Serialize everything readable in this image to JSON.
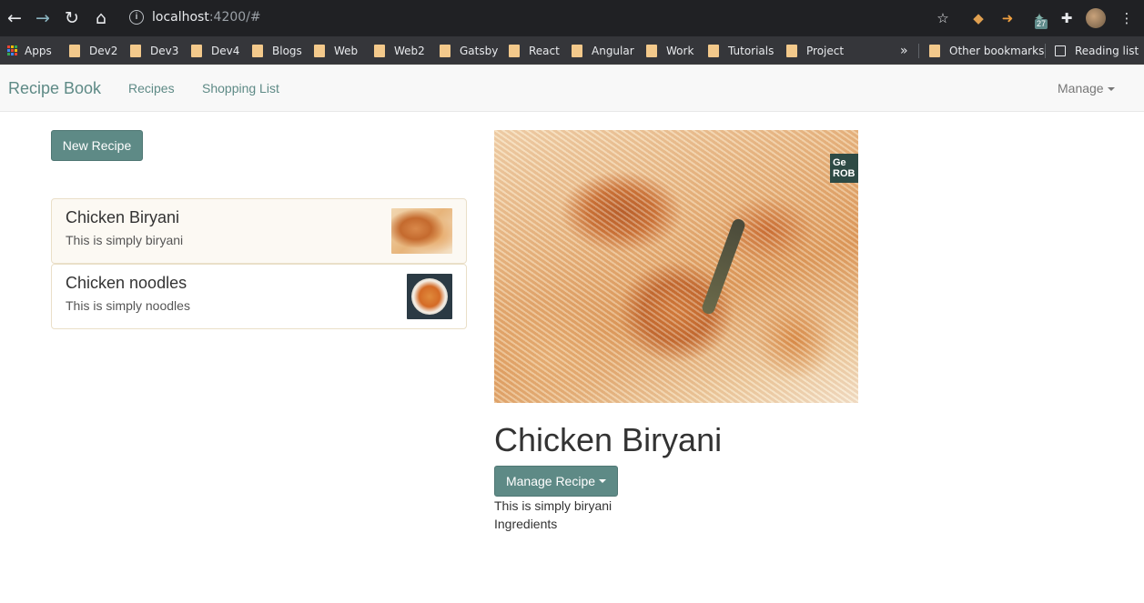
{
  "browser": {
    "url_host": "localhost",
    "url_rest": ":4200/#",
    "ext_badge": "27",
    "bookmarks": [
      "Apps",
      "Dev2",
      "Dev3",
      "Dev4",
      "Blogs",
      "Web",
      "Web2",
      "Gatsby",
      "React",
      "Angular",
      "Work",
      "Tutorials",
      "Project"
    ],
    "other_bookmarks": "Other bookmarks",
    "reading_list": "Reading list",
    "overflow": "»"
  },
  "navbar": {
    "brand": "Recipe Book",
    "links": [
      "Recipes",
      "Shopping List"
    ],
    "manage": "Manage"
  },
  "recipes": {
    "new_button": "New Recipe",
    "items": [
      {
        "name": "Chicken Biryani",
        "description": "This is simply biryani"
      },
      {
        "name": "Chicken noodles",
        "description": "This is simply noodles"
      }
    ]
  },
  "detail": {
    "title": "Chicken Biryani",
    "manage_button": "Manage Recipe",
    "description": "This is simply biryani",
    "ingredients_label": "Ingredients",
    "image_logo_text": "Ge\nROB"
  },
  "colors": {
    "accent": "#5e8a86",
    "chrome": "#202124",
    "bookmark_bar": "#35363a"
  }
}
